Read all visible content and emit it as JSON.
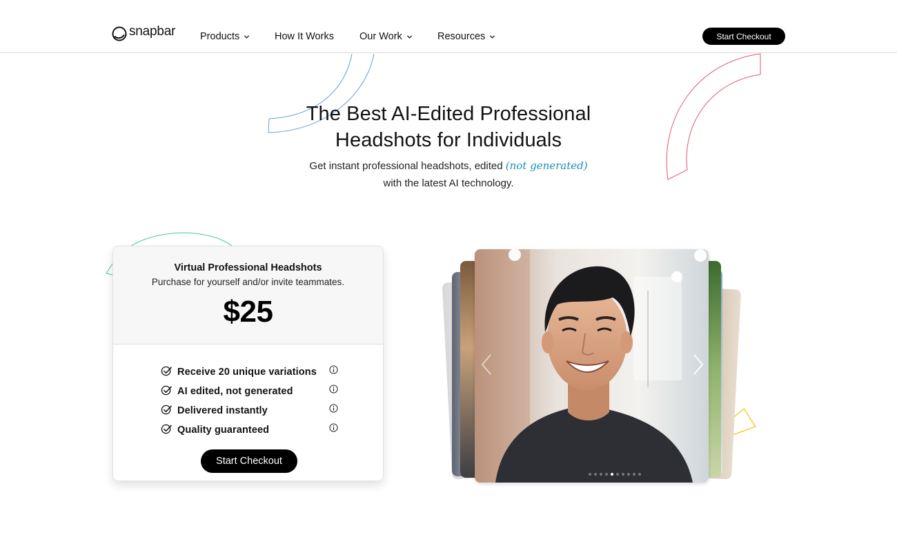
{
  "nav": {
    "logo_text": "snapbar",
    "links": [
      {
        "label": "Products",
        "has_dropdown": true
      },
      {
        "label": "How It Works",
        "has_dropdown": false
      },
      {
        "label": "Our Work",
        "has_dropdown": true
      },
      {
        "label": "Resources",
        "has_dropdown": true
      }
    ],
    "cta_label": "Start Checkout"
  },
  "hero": {
    "title_line1": "The Best AI-Edited Professional",
    "title_line2": "Headshots for Individuals",
    "subtitle_part1": "Get instant professional headshots, edited",
    "subtitle_accent": "(not generated)",
    "subtitle_part2": "with the latest AI technology."
  },
  "pricing": {
    "title": "Virtual Professional Headshots",
    "description": "Purchase for yourself and/or invite teammates.",
    "price": "$25",
    "features": [
      {
        "label": "Receive 20 unique variations"
      },
      {
        "label": "AI edited, not generated"
      },
      {
        "label": "Delivered instantly"
      },
      {
        "label": "Quality guaranteed"
      }
    ],
    "cta_label": "Start Checkout"
  },
  "carousel": {
    "slide_count": 10,
    "active_slide": 4
  },
  "colors": {
    "accent_text": "#1a8fb6",
    "decor_blue": "#6a9bd8",
    "decor_red": "#e0566f",
    "decor_green": "#3fc9a6",
    "decor_yellow": "#f2c417",
    "button_bg": "#000000"
  },
  "icons": {
    "logo": "snapbar-logo-icon",
    "dropdown": "chevron-down-icon",
    "feature_check": "check-circle-icon",
    "feature_info": "info-icon",
    "carousel_prev": "chevron-left-icon",
    "carousel_next": "chevron-right-icon"
  }
}
